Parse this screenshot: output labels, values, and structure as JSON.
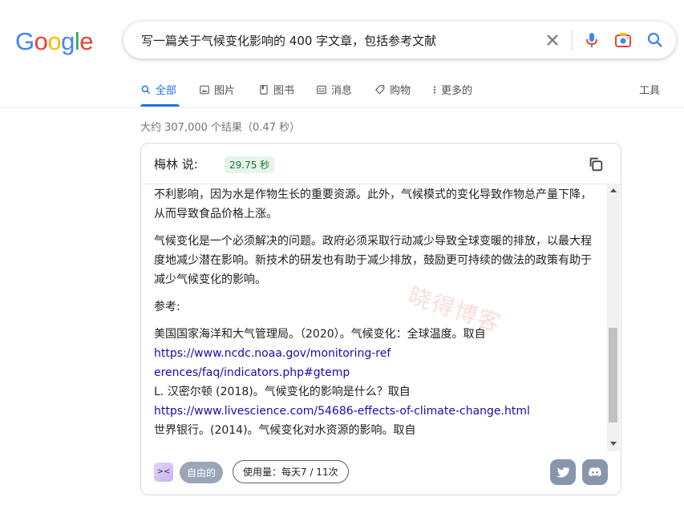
{
  "logo": {
    "letters": [
      "G",
      "o",
      "o",
      "g",
      "l",
      "e"
    ],
    "colors": [
      "#4285F4",
      "#EA4335",
      "#FBBC05",
      "#4285F4",
      "#34A853",
      "#EA4335"
    ]
  },
  "search": {
    "query": "写一篇关于气候变化影响的 400 字文章，包括参考文献",
    "icons": [
      "close-icon",
      "microphone-icon",
      "camera-icon",
      "search-icon"
    ]
  },
  "tabs": [
    {
      "label": "全部",
      "icon": "search-icon",
      "active": true
    },
    {
      "label": "图片",
      "icon": "image-icon"
    },
    {
      "label": "图书",
      "icon": "book-icon"
    },
    {
      "label": "消息",
      "icon": "news-icon"
    },
    {
      "label": "购物",
      "icon": "tag-icon"
    },
    {
      "label": "更多的",
      "icon": "more-icon"
    }
  ],
  "tools_label": "工具",
  "stats": "大约 307,000 个结果（0.47 秒）",
  "card": {
    "title": "梅林 说:",
    "time": "29.75 秒",
    "paragraphs": [
      "不利影响，因为水是作物生长的重要资源。此外，气候模式的变化导致作物总产量下降，从而导致食品价格上涨。",
      "气候变化是一个必须解决的问题。政府必须采取行动减少导致全球变暖的排放，以最大程度地减少潜在影响。新技术的研发也有助于减少排放，鼓励更可持续的做法的政策有助于减少气候变化的影响。",
      "参考:"
    ],
    "references": [
      "美国国家海洋和大气管理局。（2020）。气候变化：全球温度。取自",
      "https://www.ncdc.noaa.gov/monitoring-references/faq/indicators.php#gtemp",
      "L. 汉密尔顿 (2018)。气候变化的影响是什么？取自",
      "https://www.livescience.com/54686-effects-of-climate-change.html",
      "世界银行。(2014)。气候变化对水资源的影响。取自"
    ],
    "footer": {
      "free_label": "自由的",
      "usage_label": "使用量：每天7 / 11次",
      "social": [
        "twitter-icon",
        "discord-icon"
      ]
    }
  },
  "watermark": "晓得博客"
}
